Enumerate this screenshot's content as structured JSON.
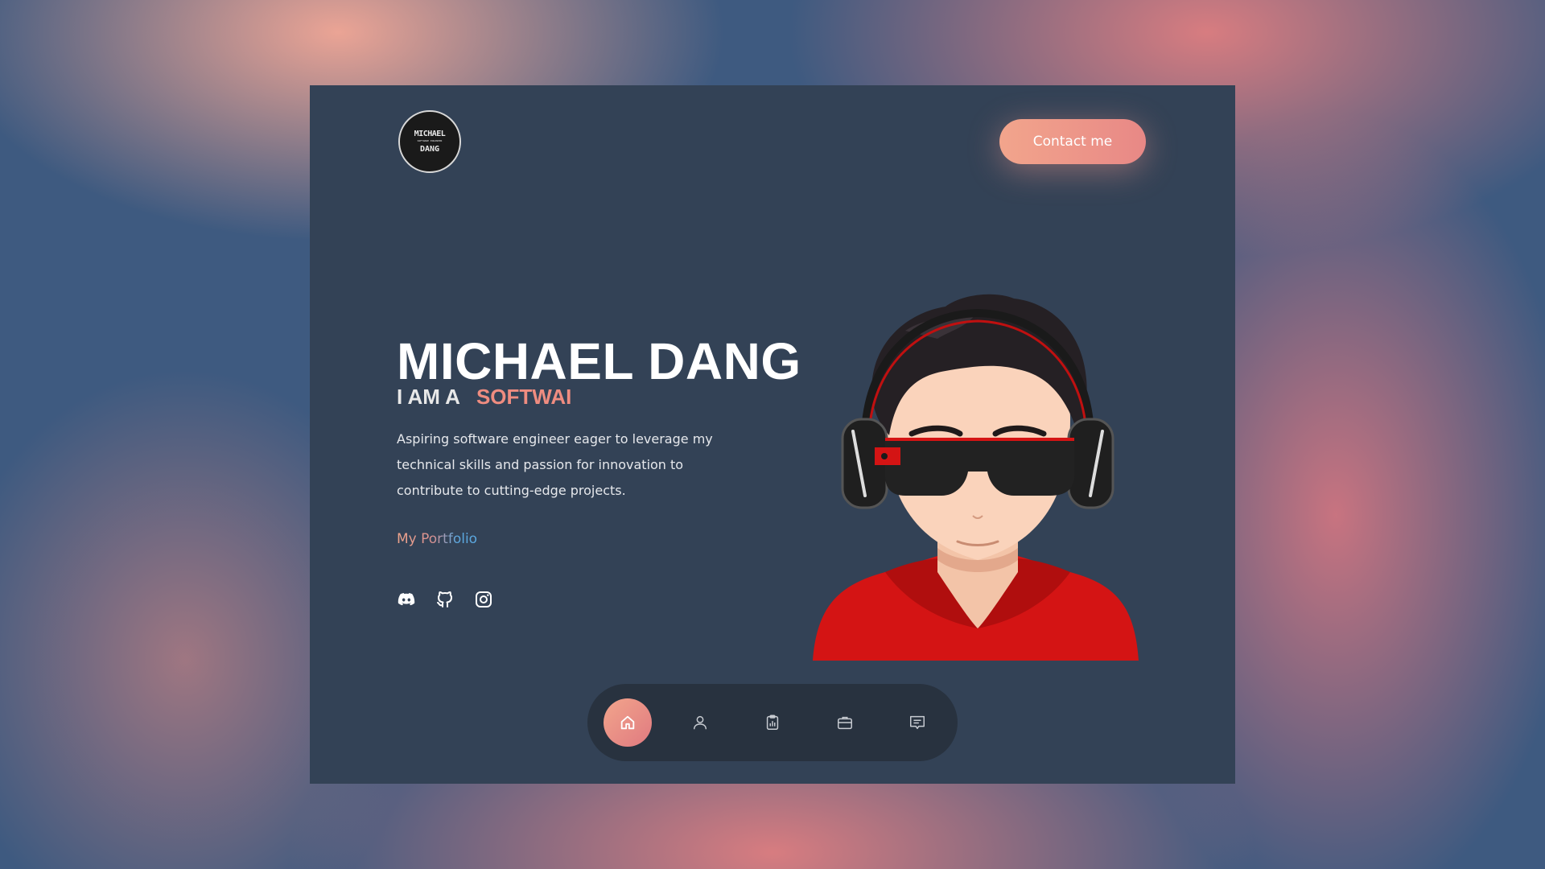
{
  "header": {
    "logo": {
      "line1": "MICHAEL",
      "line2": "SOFTWARE ENGINEER",
      "line3": "DANG"
    },
    "contact_label": "Contact me"
  },
  "hero": {
    "name": "MICHAEL DANG",
    "role_prefix": "I AM A",
    "role_typed": "SOFTWAI",
    "bio": "Aspiring software engineer eager to leverage my technical skills and passion for innovation to contribute to cutting-edge projects.",
    "portfolio_label": "My Portfolio"
  },
  "socials": [
    {
      "icon": "discord-icon"
    },
    {
      "icon": "github-icon"
    },
    {
      "icon": "instagram-icon"
    }
  ],
  "nav": {
    "items": [
      {
        "icon": "home-icon",
        "active": true
      },
      {
        "icon": "user-icon",
        "active": false
      },
      {
        "icon": "clipboard-chart-icon",
        "active": false
      },
      {
        "icon": "briefcase-icon",
        "active": false
      },
      {
        "icon": "message-icon",
        "active": false
      }
    ]
  },
  "colors": {
    "panel": "#334256",
    "accent_start": "#f2a58c",
    "accent_end": "#e88886",
    "role_text": "#ef8c80",
    "nav_bg": "#28323f",
    "hoodie": "#d41414"
  }
}
